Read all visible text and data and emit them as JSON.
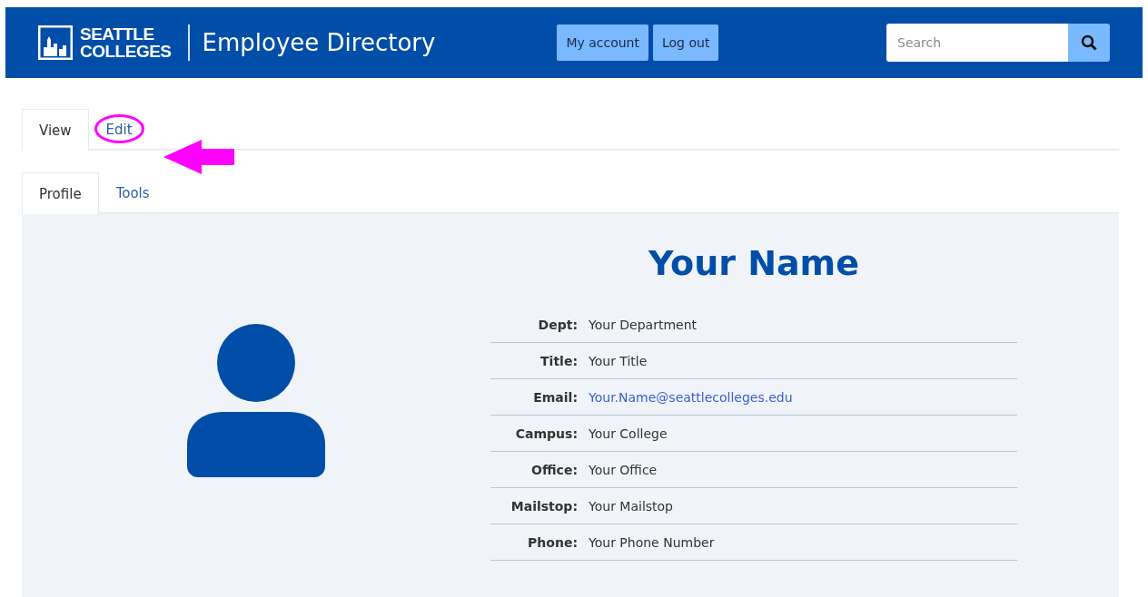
{
  "header": {
    "logo_lines": [
      "SEATTLE",
      "COLLEGES"
    ],
    "title": "Employee Directory",
    "buttons": [
      "My account",
      "Log out"
    ],
    "search": {
      "placeholder": "Search"
    }
  },
  "tabs": [
    {
      "label": "View",
      "selected": true,
      "highlighted": false
    },
    {
      "label": "Edit",
      "selected": false,
      "highlighted": true
    }
  ],
  "subtabs": [
    {
      "label": "Profile",
      "selected": true
    },
    {
      "label": "Tools",
      "selected": false
    }
  ],
  "profile": {
    "name": "Your Name",
    "fields": [
      {
        "label": "Dept:",
        "value": "Your Department",
        "kind": "text"
      },
      {
        "label": "Title:",
        "value": "Your Title",
        "kind": "text"
      },
      {
        "label": "Email:",
        "value": "Your.Name@seattlecolleges.edu",
        "kind": "link"
      },
      {
        "label": "Campus:",
        "value": "Your College",
        "kind": "text"
      },
      {
        "label": "Office:",
        "value": "Your Office",
        "kind": "text"
      },
      {
        "label": "Mailstop:",
        "value": "Your Mailstop",
        "kind": "text"
      },
      {
        "label": "Phone:",
        "value": "Your Phone Number",
        "kind": "text"
      }
    ]
  }
}
